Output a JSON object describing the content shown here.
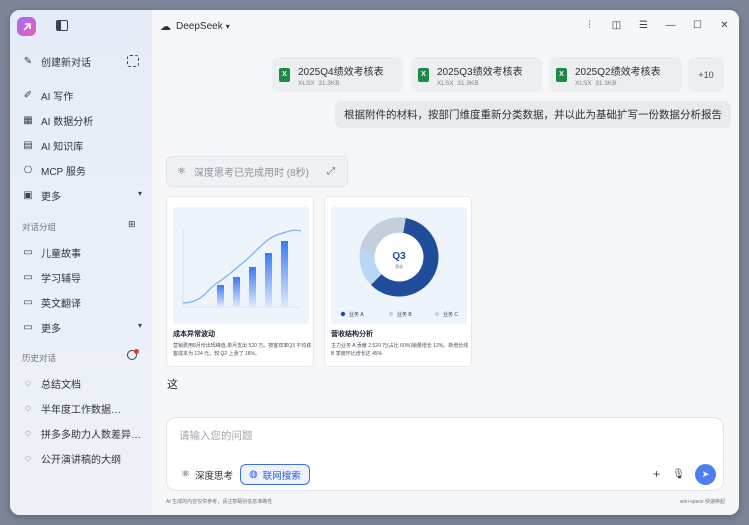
{
  "topbar": {
    "model": "DeepSeek"
  },
  "sidebar": {
    "new_chat": "创建新对话",
    "items": [
      {
        "label": "AI 写作",
        "icon": "pen-icon"
      },
      {
        "label": "AI 数据分析",
        "icon": "chart-icon"
      },
      {
        "label": "AI 知识库",
        "icon": "book-icon"
      },
      {
        "label": "MCP 服务",
        "icon": "plug-icon"
      },
      {
        "label": "更多",
        "icon": "grid-icon"
      }
    ],
    "groups_title": "对话分组",
    "groups": [
      {
        "label": "儿童故事"
      },
      {
        "label": "学习辅导"
      },
      {
        "label": "英文翻译"
      },
      {
        "label": "更多"
      }
    ],
    "history_title": "历史对话",
    "history": [
      {
        "label": "总结文档"
      },
      {
        "label": "半年度工作数据…"
      },
      {
        "label": "拼多多助力人数差异…"
      },
      {
        "label": "公开演讲稿的大纲"
      }
    ]
  },
  "attachments": [
    {
      "name": "2025Q4绩效考核表",
      "type": "XLSX",
      "size": "31.3KB"
    },
    {
      "name": "2025Q3绩效考核表",
      "type": "XLSX",
      "size": "31.3KB"
    },
    {
      "name": "2025Q2绩效考核表",
      "type": "XLSX",
      "size": "31.3KB"
    }
  ],
  "attachments_more": "+10",
  "user_message": "根据附件的材料，按部门维度重新分类数据，并以此为基础扩写一份数据分析报告",
  "thinking": {
    "label": "深度思考已完成用时 (8秒)"
  },
  "cards": [
    {
      "title": "成本异常波动",
      "desc": "营销费用8月份出现峰值,单月支出 520 万。按客双率Q3 平均获客成本为 124 元，较 Q2 上涨了 18%。"
    },
    {
      "title": "营收结构分析",
      "desc": "主力业务 A 贡献 2,520 万(占比 60%)销量增长 12%。新增长线 B 季度环比增长达 45%",
      "donut_center": "Q3",
      "donut_sub": "营收",
      "legend": [
        "业务 A",
        "业务 B",
        "业务 C"
      ],
      "colors": [
        "#1f4d9a",
        "#c3cfdd",
        "#b9d6f7"
      ]
    }
  ],
  "assistant_reply": "这",
  "composer": {
    "placeholder": "请输入您的问题",
    "deep_think": "深度思考",
    "web_search": "联网搜索"
  },
  "footer": {
    "disclaimer": "AI 生成的内容仅供参考，请注意甄别信息准确性",
    "shortcut": "win+space 快速唤起"
  }
}
